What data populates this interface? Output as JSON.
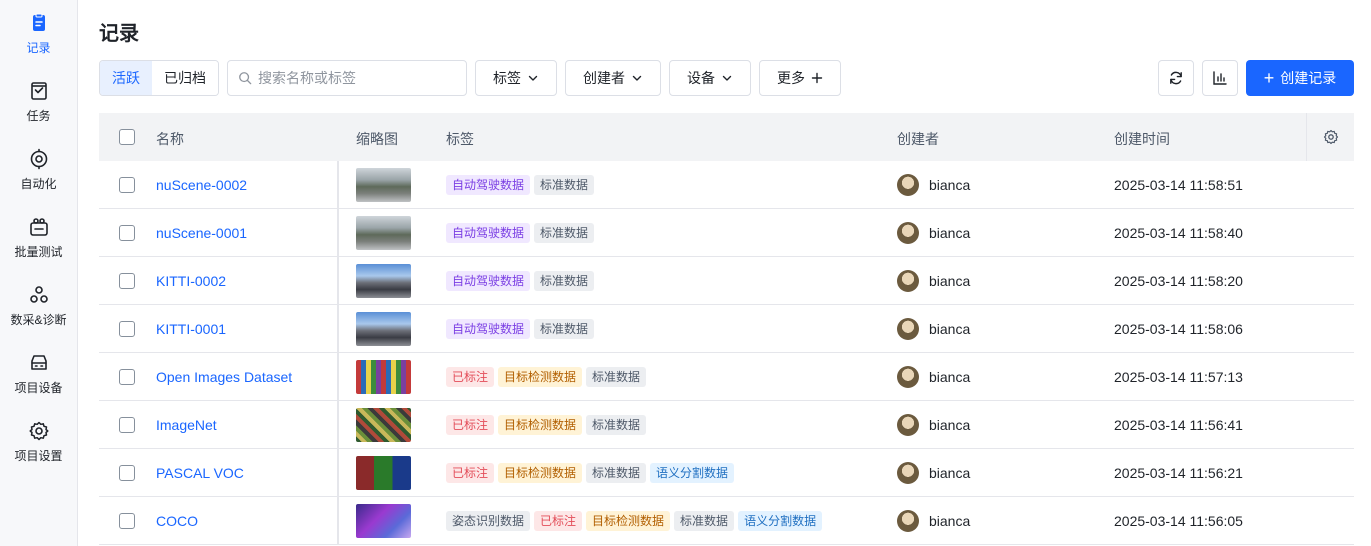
{
  "sidebar": {
    "items": [
      {
        "label": "记录",
        "icon": "record-icon",
        "active": true
      },
      {
        "label": "任务",
        "icon": "task-icon",
        "active": false
      },
      {
        "label": "自动化",
        "icon": "automation-icon",
        "active": false
      },
      {
        "label": "批量测试",
        "icon": "batch-test-icon",
        "active": false
      },
      {
        "label": "数采&诊断",
        "icon": "diagnosis-icon",
        "active": false
      },
      {
        "label": "项目设备",
        "icon": "device-icon",
        "active": false
      },
      {
        "label": "项目设置",
        "icon": "settings-icon",
        "active": false
      }
    ]
  },
  "page": {
    "title": "记录"
  },
  "toolbar": {
    "seg_active": "活跃",
    "seg_archived": "已归档",
    "search_placeholder": "搜索名称或标签",
    "filter_tags": "标签",
    "filter_creator": "创建者",
    "filter_device": "设备",
    "more": "更多",
    "create_label": "创建记录"
  },
  "table": {
    "headers": {
      "name": "名称",
      "thumbnail": "缩略图",
      "tags": "标签",
      "creator": "创建者",
      "created_at": "创建时间"
    },
    "rows": [
      {
        "name": "nuScene-0002",
        "thumb": "road-gray",
        "tags": [
          {
            "text": "自动驾驶数据",
            "kind": "purple"
          },
          {
            "text": "标准数据",
            "kind": "gray"
          }
        ],
        "creator": "bianca",
        "time": "2025-03-14 11:58:51"
      },
      {
        "name": "nuScene-0001",
        "thumb": "road-gray",
        "tags": [
          {
            "text": "自动驾驶数据",
            "kind": "purple"
          },
          {
            "text": "标准数据",
            "kind": "gray"
          }
        ],
        "creator": "bianca",
        "time": "2025-03-14 11:58:40"
      },
      {
        "name": "KITTI-0002",
        "thumb": "street-blue",
        "tags": [
          {
            "text": "自动驾驶数据",
            "kind": "purple"
          },
          {
            "text": "标准数据",
            "kind": "gray"
          }
        ],
        "creator": "bianca",
        "time": "2025-03-14 11:58:20"
      },
      {
        "name": "KITTI-0001",
        "thumb": "street-blue",
        "tags": [
          {
            "text": "自动驾驶数据",
            "kind": "purple"
          },
          {
            "text": "标准数据",
            "kind": "gray"
          }
        ],
        "creator": "bianca",
        "time": "2025-03-14 11:58:06"
      },
      {
        "name": "Open Images Dataset",
        "thumb": "mosaic",
        "tags": [
          {
            "text": "已标注",
            "kind": "red"
          },
          {
            "text": "目标检测数据",
            "kind": "orange"
          },
          {
            "text": "标准数据",
            "kind": "gray"
          }
        ],
        "creator": "bianca",
        "time": "2025-03-14 11:57:13"
      },
      {
        "name": "ImageNet",
        "thumb": "mosaic-green",
        "tags": [
          {
            "text": "已标注",
            "kind": "red"
          },
          {
            "text": "目标检测数据",
            "kind": "orange"
          },
          {
            "text": "标准数据",
            "kind": "gray"
          }
        ],
        "creator": "bianca",
        "time": "2025-03-14 11:56:41"
      },
      {
        "name": "PASCAL VOC",
        "thumb": "segmentation",
        "tags": [
          {
            "text": "已标注",
            "kind": "red"
          },
          {
            "text": "目标检测数据",
            "kind": "orange"
          },
          {
            "text": "标准数据",
            "kind": "gray"
          },
          {
            "text": "语义分割数据",
            "kind": "blue"
          }
        ],
        "creator": "bianca",
        "time": "2025-03-14 11:56:21"
      },
      {
        "name": "COCO",
        "thumb": "purple-scene",
        "tags": [
          {
            "text": "姿态识别数据",
            "kind": "gray"
          },
          {
            "text": "已标注",
            "kind": "red"
          },
          {
            "text": "目标检测数据",
            "kind": "orange"
          },
          {
            "text": "标准数据",
            "kind": "gray"
          },
          {
            "text": "语义分割数据",
            "kind": "blue"
          }
        ],
        "creator": "bianca",
        "time": "2025-03-14 11:56:05"
      }
    ]
  },
  "colors": {
    "accent": "#1a66ff",
    "tag_purple_bg": "#f0e8ff",
    "tag_purple_fg": "#7b3fe4",
    "tag_gray_bg": "#eceef1",
    "tag_gray_fg": "#4e5969",
    "tag_red_bg": "#fde7e7",
    "tag_red_fg": "#e34d59",
    "tag_orange_bg": "#fff3d6",
    "tag_orange_fg": "#b25f00",
    "tag_blue_bg": "#e3f2ff",
    "tag_blue_fg": "#1f6fc1"
  }
}
